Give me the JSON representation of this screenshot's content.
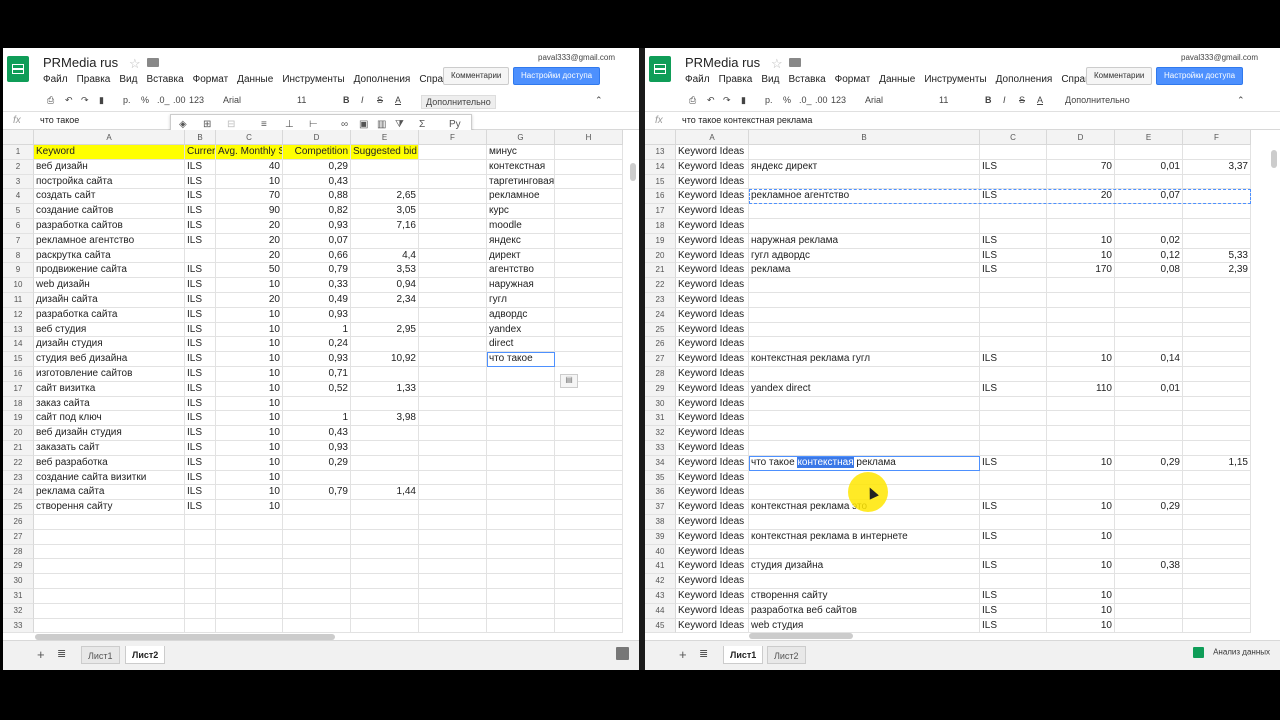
{
  "app": {
    "title": "PRMedia rus",
    "email": "paval333@gmail.com",
    "comments_label": "Комментарии",
    "share_label": "Настройки доступа"
  },
  "menu": [
    "Файл",
    "Правка",
    "Вид",
    "Вставка",
    "Формат",
    "Данные",
    "Инструменты",
    "Дополнения",
    "Справка"
  ],
  "toolbar": {
    "currency": "р.",
    "percent": "%",
    "dec_less": ".0_",
    "dec_more": ".00",
    "format123": "123",
    "font": "Arial",
    "size": "11",
    "bold": "B",
    "italic": "I",
    "strike": "S",
    "textcolor": "A",
    "more": "Дополнительно"
  },
  "left": {
    "formula": "что такое",
    "columns": [
      "A",
      "B",
      "C",
      "D",
      "E",
      "F",
      "G",
      "H"
    ],
    "header_row": [
      "Keyword",
      "Currer",
      "Avg. Monthly S",
      "Competition",
      "Suggested bid",
      "",
      "минус",
      ""
    ],
    "rows": [
      [
        "веб дизайн",
        "ILS",
        "40",
        "0,29",
        "",
        "",
        "контекстная",
        ""
      ],
      [
        "постройка сайта",
        "ILS",
        "10",
        "0,43",
        "",
        "",
        "таргетинговая",
        ""
      ],
      [
        "создать сайт",
        "ILS",
        "70",
        "0,88",
        "2,65",
        "",
        "рекламное",
        ""
      ],
      [
        "создание сайтов",
        "ILS",
        "90",
        "0,82",
        "3,05",
        "",
        "курс",
        ""
      ],
      [
        "разработка сайтов",
        "ILS",
        "20",
        "0,93",
        "7,16",
        "",
        "moodle",
        ""
      ],
      [
        "рекламное агентство",
        "ILS",
        "20",
        "0,07",
        "",
        "",
        "яндекс",
        ""
      ],
      [
        "раскрутка сайта",
        "",
        "20",
        "0,66",
        "4,4",
        "",
        "директ",
        ""
      ],
      [
        "продвижение сайта",
        "ILS",
        "50",
        "0,79",
        "3,53",
        "",
        "агентство",
        ""
      ],
      [
        "web дизайн",
        "ILS",
        "10",
        "0,33",
        "0,94",
        "",
        "наружная",
        ""
      ],
      [
        "дизайн сайта",
        "ILS",
        "20",
        "0,49",
        "2,34",
        "",
        "гугл",
        ""
      ],
      [
        "разработка сайта",
        "ILS",
        "10",
        "0,93",
        "",
        "",
        "адвордс",
        ""
      ],
      [
        "веб студия",
        "ILS",
        "10",
        "1",
        "2,95",
        "",
        "yandex",
        ""
      ],
      [
        "дизайн студия",
        "ILS",
        "10",
        "0,24",
        "",
        "",
        "direct",
        ""
      ],
      [
        "студия веб дизайна",
        "ILS",
        "10",
        "0,93",
        "10,92",
        "",
        "что такое",
        ""
      ],
      [
        "изготовление сайтов",
        "ILS",
        "10",
        "0,71",
        "",
        "",
        "",
        ""
      ],
      [
        "сайт визитка",
        "ILS",
        "10",
        "0,52",
        "1,33",
        "",
        "",
        ""
      ],
      [
        "заказ сайта",
        "ILS",
        "10",
        "",
        "",
        "",
        "",
        ""
      ],
      [
        "сайт под ключ",
        "ILS",
        "10",
        "1",
        "3,98",
        "",
        "",
        ""
      ],
      [
        "веб дизайн студия",
        "ILS",
        "10",
        "0,43",
        "",
        "",
        "",
        ""
      ],
      [
        "заказать сайт",
        "ILS",
        "10",
        "0,93",
        "",
        "",
        "",
        ""
      ],
      [
        "веб разработка",
        "ILS",
        "10",
        "0,29",
        "",
        "",
        "",
        ""
      ],
      [
        "создание сайта визитки",
        "ILS",
        "10",
        "",
        "",
        "",
        "",
        ""
      ],
      [
        "реклама сайта",
        "ILS",
        "10",
        "0,79",
        "1,44",
        "",
        "",
        ""
      ],
      [
        "створення сайту",
        "ILS",
        "10",
        "",
        "",
        "",
        "",
        ""
      ],
      [
        "",
        "",
        "",
        "",
        "",
        "",
        "",
        ""
      ],
      [
        "",
        "",
        "",
        "",
        "",
        "",
        "",
        ""
      ],
      [
        "",
        "",
        "",
        "",
        "",
        "",
        "",
        ""
      ],
      [
        "",
        "",
        "",
        "",
        "",
        "",
        "",
        ""
      ],
      [
        "",
        "",
        "",
        "",
        "",
        "",
        "",
        ""
      ],
      [
        "",
        "",
        "",
        "",
        "",
        "",
        "",
        ""
      ],
      [
        "",
        "",
        "",
        "",
        "",
        "",
        "",
        ""
      ],
      [
        "",
        "",
        "",
        "",
        "",
        "",
        "",
        ""
      ]
    ],
    "row_start": 1,
    "sheets": [
      "Лист1",
      "Лист2"
    ],
    "active_sheet": "Лист2"
  },
  "right": {
    "formula": "что такое контекстная реклама",
    "columns": [
      "A",
      "B",
      "C",
      "D",
      "E",
      "F"
    ],
    "row_start": 13,
    "rows": [
      [
        "Keyword Ideas",
        "",
        "",
        "",
        "",
        ""
      ],
      [
        "Keyword Ideas",
        "яндекс директ",
        "ILS",
        "70",
        "0,01",
        "3,37"
      ],
      [
        "Keyword Ideas",
        "",
        "",
        "",
        "",
        ""
      ],
      [
        "Keyword Ideas",
        "рекламное агентство",
        "ILS",
        "20",
        "0,07",
        ""
      ],
      [
        "Keyword Ideas",
        "",
        "",
        "",
        "",
        ""
      ],
      [
        "Keyword Ideas",
        "",
        "",
        "",
        "",
        ""
      ],
      [
        "Keyword Ideas",
        "наружная реклама",
        "ILS",
        "10",
        "0,02",
        ""
      ],
      [
        "Keyword Ideas",
        "гугл адвордс",
        "ILS",
        "10",
        "0,12",
        "5,33"
      ],
      [
        "Keyword Ideas",
        "реклама",
        "ILS",
        "170",
        "0,08",
        "2,39"
      ],
      [
        "Keyword Ideas",
        "",
        "",
        "",
        "",
        ""
      ],
      [
        "Keyword Ideas",
        "",
        "",
        "",
        "",
        ""
      ],
      [
        "Keyword Ideas",
        "",
        "",
        "",
        "",
        ""
      ],
      [
        "Keyword Ideas",
        "",
        "",
        "",
        "",
        ""
      ],
      [
        "Keyword Ideas",
        "",
        "",
        "",
        "",
        ""
      ],
      [
        "Keyword Ideas",
        "контекстная реклама гугл",
        "ILS",
        "10",
        "0,14",
        ""
      ],
      [
        "Keyword Ideas",
        "",
        "",
        "",
        "",
        ""
      ],
      [
        "Keyword Ideas",
        "yandex direct",
        "ILS",
        "110",
        "0,01",
        ""
      ],
      [
        "Keyword Ideas",
        "",
        "",
        "",
        "",
        ""
      ],
      [
        "Keyword Ideas",
        "",
        "",
        "",
        "",
        ""
      ],
      [
        "Keyword Ideas",
        "",
        "",
        "",
        "",
        ""
      ],
      [
        "Keyword Ideas",
        "",
        "",
        "",
        "",
        ""
      ],
      [
        "Keyword Ideas",
        "что такое контекстная реклама",
        "ILS",
        "10",
        "0,29",
        "1,15"
      ],
      [
        "Keyword Ideas",
        "",
        "",
        "",
        "",
        ""
      ],
      [
        "Keyword Ideas",
        "",
        "",
        "",
        "",
        ""
      ],
      [
        "Keyword Ideas",
        "контекстная реклама это",
        "ILS",
        "10",
        "0,29",
        ""
      ],
      [
        "Keyword Ideas",
        "",
        "",
        "",
        "",
        ""
      ],
      [
        "Keyword Ideas",
        "контекстная реклама в интернете",
        "ILS",
        "10",
        "",
        ""
      ],
      [
        "Keyword Ideas",
        "",
        "",
        "",
        "",
        ""
      ],
      [
        "Keyword Ideas",
        "студия дизайна",
        "ILS",
        "10",
        "0,38",
        ""
      ],
      [
        "Keyword Ideas",
        "",
        "",
        "",
        "",
        ""
      ],
      [
        "Keyword Ideas",
        "створення сайту",
        "ILS",
        "10",
        "",
        ""
      ],
      [
        "Keyword Ideas",
        "разработка веб сайтов",
        "ILS",
        "10",
        "",
        ""
      ],
      [
        "Keyword Ideas",
        "web студия",
        "ILS",
        "10",
        "",
        ""
      ]
    ],
    "sheets": [
      "Лист1",
      "Лист2"
    ],
    "active_sheet": "Лист1",
    "explore_label": "Анализ данных"
  }
}
